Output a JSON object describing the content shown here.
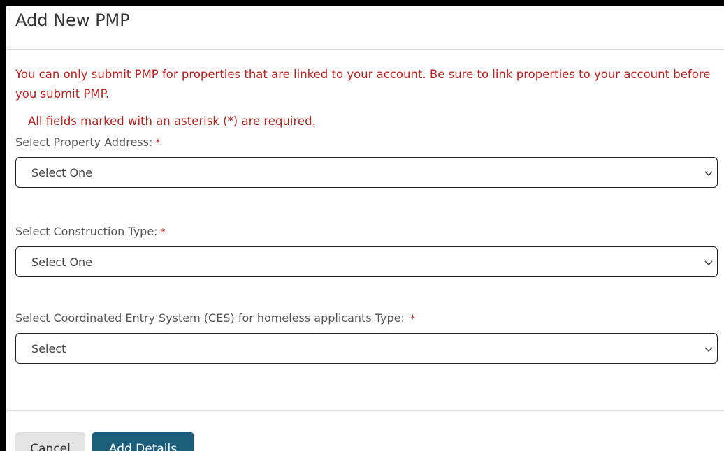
{
  "modal": {
    "title": "Add New PMP",
    "warning": "You can only submit PMP for properties that are linked to your account. Be sure to link properties to your account before you submit PMP.",
    "required_note": "All fields marked with an asterisk (*) are required.",
    "asterisk": "*"
  },
  "fields": {
    "property": {
      "label": "Select Property Address:",
      "value": "Select One"
    },
    "construction": {
      "label": "Select Construction Type:",
      "value": "Select One"
    },
    "ces": {
      "label": "Select Coordinated Entry System (CES) for homeless applicants Type:",
      "value": "Select"
    }
  },
  "buttons": {
    "cancel": "Cancel",
    "add_details": "Add Details"
  },
  "colors": {
    "warning_text": "#b22222",
    "primary_button": "#1d5f7a",
    "secondary_button": "#e4e4e4"
  },
  "icons": {
    "dropdown": "chevron-down-icon"
  }
}
